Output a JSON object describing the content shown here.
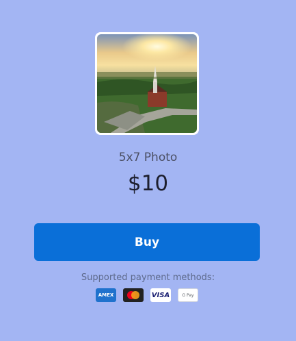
{
  "product": {
    "image_alt": "Aerial photo of a church at sunset",
    "title": "5x7 Photo",
    "price": "$10"
  },
  "actions": {
    "buy_label": "Buy"
  },
  "payment": {
    "supported_label": "Supported payment methods:",
    "methods": [
      {
        "icon": "amex-icon",
        "label": "AMEX"
      },
      {
        "icon": "mastercard-icon",
        "label": ""
      },
      {
        "icon": "visa-icon",
        "label": "VISA"
      },
      {
        "icon": "google-pay-icon",
        "label": "G Pay"
      }
    ]
  },
  "colors": {
    "background": "#a3b5f3",
    "button": "#0a6fd8",
    "button_text": "#ffffff",
    "title_text": "#4b4f63",
    "price_text": "#1d1f2e",
    "muted_text": "#5e6a8c"
  }
}
